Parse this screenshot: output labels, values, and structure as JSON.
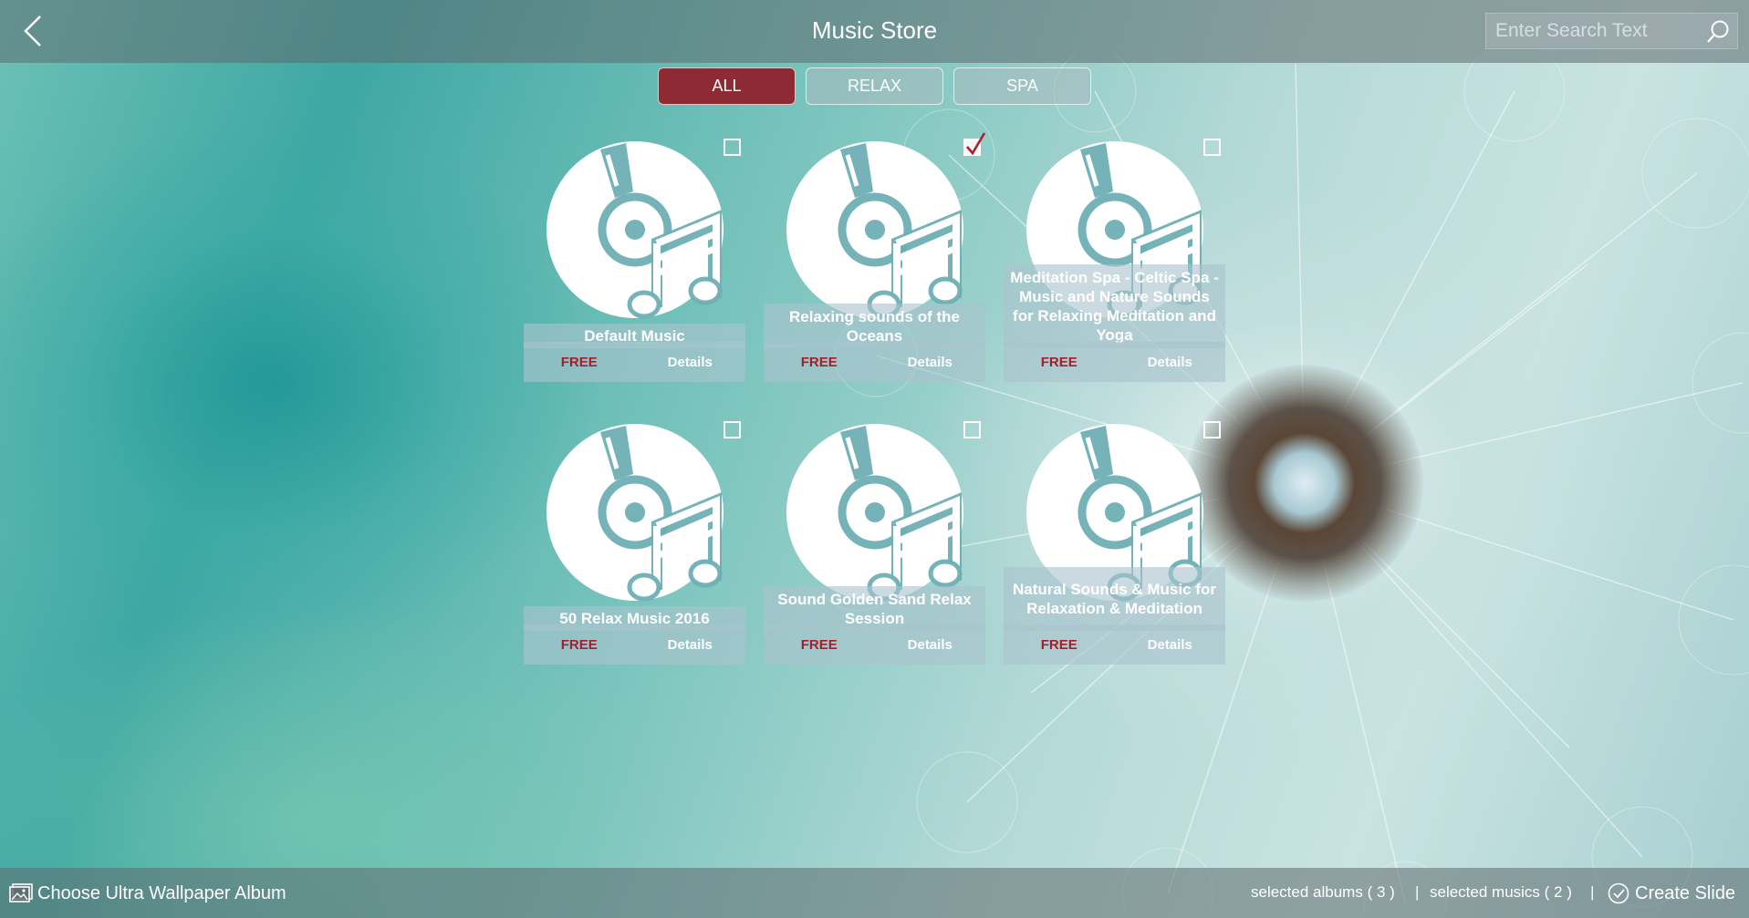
{
  "header": {
    "title": "Music Store",
    "search_placeholder": "Enter Search Text"
  },
  "tabs": [
    {
      "label": "ALL",
      "active": true
    },
    {
      "label": "RELAX",
      "active": false
    },
    {
      "label": "SPA",
      "active": false
    }
  ],
  "albums": [
    {
      "name": "Default Music",
      "price": "FREE",
      "details": "Details",
      "checked": false
    },
    {
      "name": "Relaxing sounds of the Oceans",
      "price": "FREE",
      "details": "Details",
      "checked": true
    },
    {
      "name": "Meditation Spa - Celtic Spa - Music and Nature Sounds for Relaxing Meditation and Yoga",
      "price": "FREE",
      "details": "Details",
      "checked": false
    },
    {
      "name": "50 Relax Music 2016",
      "price": "FREE",
      "details": "Details",
      "checked": false
    },
    {
      "name": "Sound Golden Sand Relax Session",
      "price": "FREE",
      "details": "Details",
      "checked": false
    },
    {
      "name": "Natural Sounds & Music for Relaxation & Meditation",
      "price": "FREE",
      "details": "Details",
      "checked": false
    }
  ],
  "footer": {
    "wallpaper_label": "Choose Ultra Wallpaper Album",
    "selected_albums": "selected albums ( 3 )",
    "selected_musics": "selected musics ( 2 )",
    "separator": "|",
    "create_label": "Create Slide"
  },
  "colors": {
    "accent_active_tab": "#8e2a33",
    "free_text": "#a41e2c",
    "bar_overlay": "rgba(95,105,110,0.55)"
  }
}
